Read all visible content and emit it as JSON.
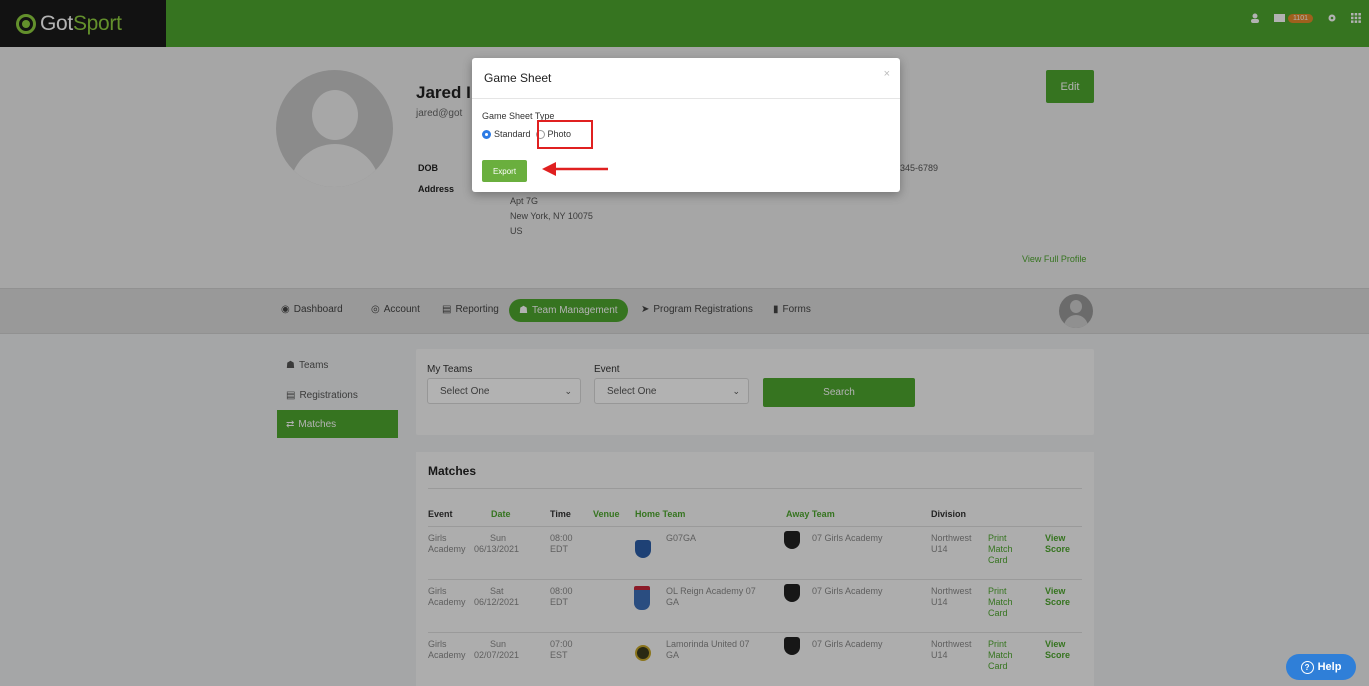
{
  "app": {
    "logo_got": "Got",
    "logo_sport": "Sport",
    "notification_count": "1101"
  },
  "profile": {
    "name": "Jared I",
    "email": "jared@got",
    "dob_label": "DOB",
    "address_label": "Address",
    "address_lines": [
      "Apt 7G",
      "New York, NY 10075",
      "US"
    ],
    "phone_fragment": "345-6789",
    "edit_label": "Edit",
    "view_full_profile": "View Full Profile"
  },
  "nav": {
    "items": [
      {
        "label": "Dashboard",
        "icon": "dashboard-icon"
      },
      {
        "label": "Account",
        "icon": "account-icon"
      },
      {
        "label": "Reporting",
        "icon": "reporting-icon"
      },
      {
        "label": "Team Management",
        "icon": "team-icon",
        "active": true
      },
      {
        "label": "Program Registrations",
        "icon": "send-icon"
      },
      {
        "label": "Forms",
        "icon": "forms-icon"
      }
    ]
  },
  "sidebar": {
    "items": [
      {
        "label": "Teams",
        "icon": "teams-icon"
      },
      {
        "label": "Registrations",
        "icon": "registrations-icon"
      },
      {
        "label": "Matches",
        "icon": "matches-icon",
        "active": true
      }
    ]
  },
  "filters": {
    "my_teams_label": "My Teams",
    "my_teams_value": "Select One",
    "event_label": "Event",
    "event_value": "Select One",
    "search_label": "Search"
  },
  "matches": {
    "title": "Matches",
    "columns": [
      "Event",
      "Date",
      "Time",
      "Venue",
      "Home Team",
      "Away Team",
      "Division"
    ],
    "rows": [
      {
        "event": [
          "Girls",
          "Academy"
        ],
        "date": [
          "Sun",
          "06/13/2021"
        ],
        "time": [
          "08:00",
          "EDT"
        ],
        "home": [
          "G07GA"
        ],
        "away": [
          "07 Girls Academy"
        ],
        "division": [
          "Northwest",
          "U14"
        ],
        "print": [
          "Print",
          "Match",
          "Card"
        ],
        "view": [
          "View",
          "Score"
        ]
      },
      {
        "event": [
          "Girls",
          "Academy"
        ],
        "date": [
          "Sat",
          "06/12/2021"
        ],
        "time": [
          "08:00",
          "EDT"
        ],
        "home": [
          "OL Reign Academy 07",
          "GA"
        ],
        "away": [
          "07 Girls Academy"
        ],
        "division": [
          "Northwest",
          "U14"
        ],
        "print": [
          "Print",
          "Match",
          "Card"
        ],
        "view": [
          "View",
          "Score"
        ]
      },
      {
        "event": [
          "Girls",
          "Academy"
        ],
        "date": [
          "Sun",
          "02/07/2021"
        ],
        "time": [
          "07:00",
          "EST"
        ],
        "home": [
          "Lamorinda United 07",
          "GA"
        ],
        "away": [
          "07 Girls Academy"
        ],
        "division": [
          "Northwest",
          "U14"
        ],
        "print": [
          "Print",
          "Match",
          "Card"
        ],
        "view": [
          "View",
          "Score"
        ]
      }
    ]
  },
  "modal": {
    "title": "Game Sheet",
    "close": "×",
    "type_label": "Game Sheet Type",
    "option_standard": "Standard",
    "option_photo": "Photo",
    "selected": "Standard",
    "export_label": "Export"
  },
  "help": {
    "label": "Help"
  },
  "colors": {
    "brand_green": "#4ea72e",
    "logo_bg": "#1a1a1a",
    "highlight_red": "#e02020",
    "help_blue": "#2f7fd8"
  }
}
